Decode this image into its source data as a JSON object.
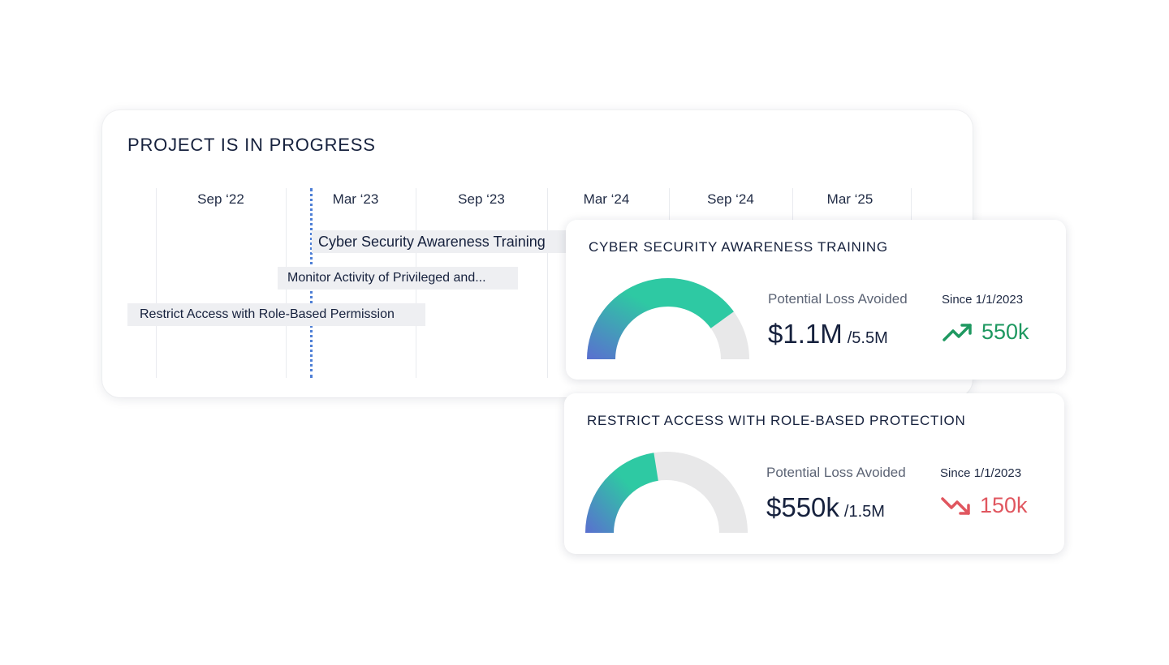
{
  "timeline": {
    "title": "PROJECT IS IN PROGRESS",
    "months": [
      "Sep ‘22",
      "Mar ‘23",
      "Sep ‘23",
      "Mar ‘24",
      "Sep ‘24",
      "Mar ‘25"
    ],
    "tasks": [
      "Cyber Security Awareness Training",
      "Monitor Activity of Privileged and...",
      "Restrict Access with Role-Based Permission"
    ]
  },
  "cards": [
    {
      "title": "CYBER SECURITY AWARENESS TRAINING",
      "metric_label": "Potential Loss Avoided",
      "value": "$1.1M",
      "of_total": "/5.5M",
      "since": "Since 1/1/2023",
      "trend_value": "550k",
      "trend_direction": "up",
      "trend_icon": "trending-up-icon",
      "gauge_fraction": 0.8
    },
    {
      "title": "RESTRICT ACCESS WITH ROLE-BASED PROTECTION",
      "metric_label": "Potential Loss Avoided",
      "value": "$550k",
      "of_total": "/1.5M",
      "since": "Since 1/1/2023",
      "trend_value": "150k",
      "trend_direction": "down",
      "trend_icon": "trending-down-icon",
      "gauge_fraction": 0.45
    }
  ],
  "colors": {
    "up": "#1e9860",
    "down": "#e0565f",
    "gauge_start": "#5a6fd0",
    "gauge_end": "#2ec9a3",
    "gauge_track": "#e8e8e9",
    "today_line": "#4e7fd6"
  }
}
